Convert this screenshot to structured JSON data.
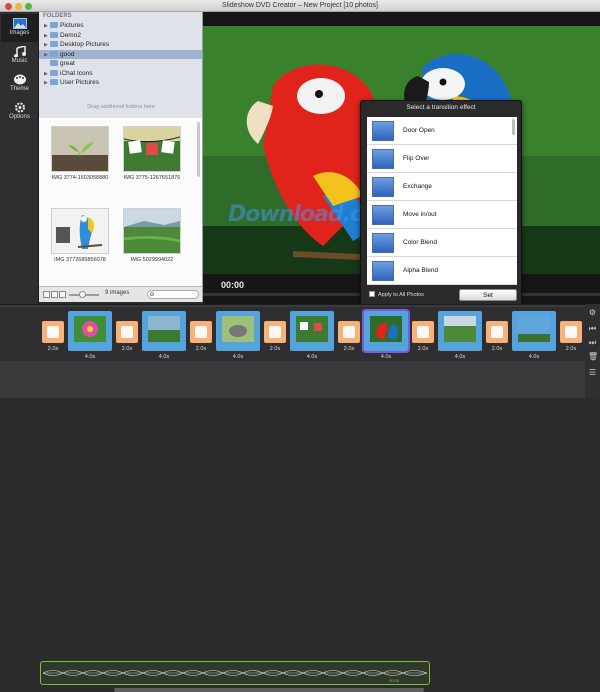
{
  "window": {
    "title": "Slideshow DVD Creator – New Project [10 photos]"
  },
  "left_toolbar": [
    {
      "label": "Images",
      "icon": "image-icon",
      "active": true
    },
    {
      "label": "Music",
      "icon": "music-note-icon",
      "active": false
    },
    {
      "label": "Theme",
      "icon": "palette-icon",
      "active": false
    },
    {
      "label": "Options",
      "icon": "gear-icon",
      "active": false
    }
  ],
  "folders": {
    "header": "FOLDERS",
    "items": [
      {
        "label": "Pictures",
        "expandable": true,
        "selected": false
      },
      {
        "label": "Demo2",
        "expandable": true,
        "selected": false
      },
      {
        "label": "Desktop Pictures",
        "expandable": true,
        "selected": false
      },
      {
        "label": "good",
        "expandable": true,
        "selected": true
      },
      {
        "label": "great",
        "expandable": false,
        "selected": false
      },
      {
        "label": "iChat Icons",
        "expandable": true,
        "selected": false
      },
      {
        "label": "User Pictures",
        "expandable": true,
        "selected": false
      }
    ],
    "drag_hint": "Drag additional folders here"
  },
  "browser": {
    "thumbnails": [
      {
        "caption": "IMG 3774-1603058880",
        "image": "sprout-on-soil"
      },
      {
        "caption": "IMG 3775-1267651876",
        "image": "hanging-notes"
      },
      {
        "caption": "IMG 3772689856078",
        "image": "macaw-on-branch"
      },
      {
        "caption": "IMG 5029994022",
        "image": "green-field"
      }
    ],
    "image_count": "9 images",
    "search_placeholder": ""
  },
  "preview": {
    "timecode": "00:00",
    "image": "macaw-pair"
  },
  "transition_popover": {
    "title": "Select a transition effect",
    "effects": [
      "Door Open",
      "Flip Over",
      "Exchange",
      "Move in/out",
      "Color Blend",
      "Alpha Blend"
    ],
    "apply_all_label": "Apply to All Photos",
    "apply_all_checked": false,
    "set_label": "Set"
  },
  "watermark": {
    "text": "Download.com.vn",
    "dot_colors": [
      "#4aa3df",
      "#f2c94c",
      "#9b6dd6",
      "#e85a5a"
    ]
  },
  "timeline": {
    "slides": [
      {
        "duration": "4.0s",
        "image": "flower"
      },
      {
        "duration": "4.0s",
        "image": "landscape"
      },
      {
        "duration": "4.0s",
        "image": "elephant"
      },
      {
        "duration": "4.0s",
        "image": "hanging-notes"
      },
      {
        "duration": "4.0s",
        "image": "macaw",
        "selected": true
      },
      {
        "duration": "4.0s",
        "image": "field"
      },
      {
        "duration": "4.0s",
        "image": "sky"
      }
    ],
    "transitions": [
      "2.0s",
      "2.0s",
      "2.0s",
      "2.0s",
      "2.0s",
      "2.0s",
      "2.0s",
      "2.0s"
    ],
    "audio_time": "00:00"
  },
  "right_toolbar": [
    "settings-icon",
    "skip-back-icon",
    "skip-forward-icon",
    "trash-icon",
    "list-icon"
  ],
  "colors": {
    "slide": "#54a3dc",
    "transition": "#f6b27a",
    "audio": "#7bc043",
    "selection": "#7a5cd6"
  }
}
